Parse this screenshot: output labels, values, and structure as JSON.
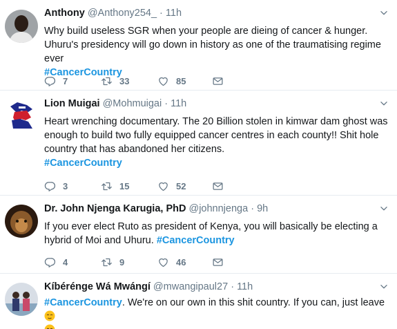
{
  "tweets": [
    {
      "name": "Anthony",
      "handle": "@Anthony254_",
      "separator": "·",
      "time": "11h",
      "text": "Why build useless SGR when your people are dieing of cancer & hunger. Uhuru's presidency will go down in history as one of the traumatising regime ever",
      "hashtag": "#CancerCountry",
      "replies": "7",
      "retweets": "33",
      "likes": "85"
    },
    {
      "name": "Lion Muigai",
      "handle": "@Mohmuigai",
      "separator": "·",
      "time": "11h",
      "text": "Heart wrenching  documentary. The 20 Billion stolen in kimwar dam ghost was enough to build two fully equipped  cancer centres in each county!!  Shit hole country that has abandoned her citizens.",
      "hashtag": "#CancerCountry",
      "replies": "3",
      "retweets": "15",
      "likes": "52"
    },
    {
      "name": "Dr. John Njenga Karugia, PhD",
      "handle": "@johnnjenga",
      "separator": "·",
      "time": "9h",
      "text": "If you ever elect Ruto as president of Kenya, you will basically be electing a hybrid of Moi and Uhuru.",
      "hashtag": "#CancerCountry",
      "replies": "4",
      "retweets": "9",
      "likes": "46"
    },
    {
      "name": "Kíbérénge Wá Mwángí",
      "handle": "@mwangipaul27",
      "separator": "·",
      "time": "11h",
      "hashtag": "#CancerCountry",
      "text": ". We're on our own in this shit country. If you can, just leave",
      "text_end": "."
    }
  ],
  "icons": {
    "reply": "reply-icon",
    "retweet": "retweet-icon",
    "like": "heart-icon",
    "dm": "envelope-icon",
    "caret": "chevron-down-icon"
  },
  "colors": {
    "hashtag": "#1b95e0",
    "meta": "#657786",
    "text": "#14171a",
    "divider": "#e6ecf0"
  }
}
